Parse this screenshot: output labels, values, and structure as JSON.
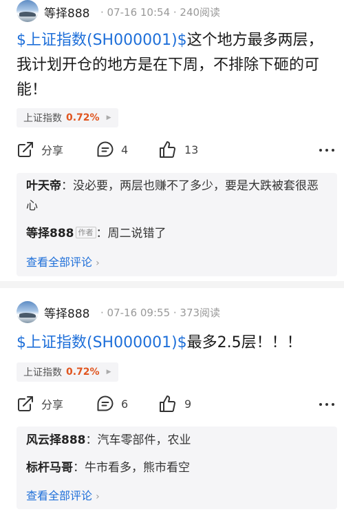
{
  "posts": [
    {
      "username": "等择888",
      "meta": "· 07-16 10:54 · 240阅读",
      "stock_link": "$上证指数(SH000001)$",
      "text": "这个地方最多两层，我计划开仓的地方是在下周，不排除下砸的可能！",
      "stock_tag": {
        "name": "上证指数",
        "pct": "0.72%"
      },
      "share_label": "分享",
      "comment_count": "4",
      "like_count": "13",
      "comments": [
        {
          "name": "叶天帝",
          "sep": "：",
          "text": "没必要，两层也赚不了多少，要是大跌被套很恶心"
        },
        {
          "name": "等择888",
          "tag": "作者",
          "sep": "：",
          "text": "周二说错了"
        }
      ],
      "view_all": "查看全部评论"
    },
    {
      "username": "等择888",
      "meta": "· 07-16 09:55 · 373阅读",
      "stock_link": "$上证指数(SH000001)$",
      "text": "最多2.5层！！！",
      "stock_tag": {
        "name": "上证指数",
        "pct": "0.72%"
      },
      "share_label": "分享",
      "comment_count": "6",
      "like_count": "9",
      "comments": [
        {
          "name": "风云择888",
          "sep": "：",
          "text": "汽车零部件，农业"
        },
        {
          "name": "标杆马哥",
          "sep": "：",
          "text": "牛市看多，熊市看空"
        }
      ],
      "view_all": "查看全部评论"
    }
  ],
  "colors": {
    "link": "#1e6fd9",
    "positive": "#e0551f"
  },
  "icons": [
    "share-icon",
    "comment-icon",
    "like-icon",
    "more-icon",
    "chevron-right-icon",
    "caret-right-icon"
  ]
}
